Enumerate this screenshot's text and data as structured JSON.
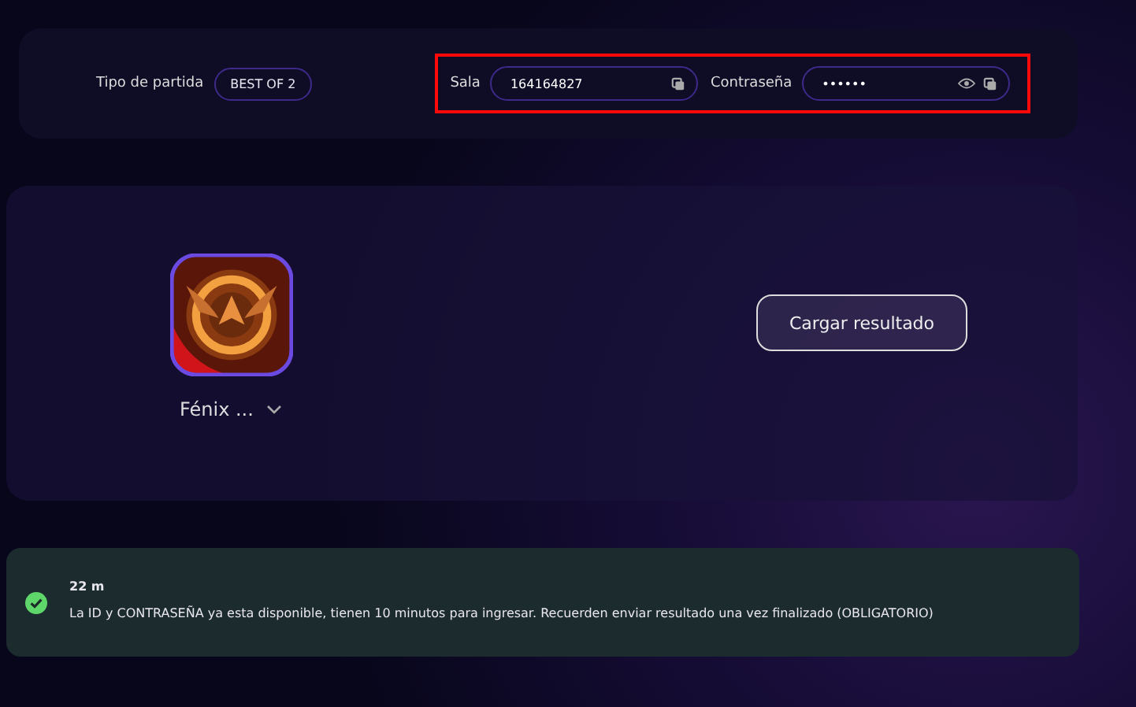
{
  "match": {
    "type_label": "Tipo de partida",
    "type_value": "BEST OF 2"
  },
  "credentials": {
    "highlighted": true,
    "room": {
      "label": "Sala",
      "value": "164164827"
    },
    "password": {
      "label": "Contraseña",
      "value": "••••••"
    }
  },
  "team": {
    "name": "Fénix ...",
    "expanded": false
  },
  "upload_button": "Cargar resultado",
  "toast": {
    "kind": "success",
    "time": "22 m",
    "message": "La ID y CONTRASEÑA ya esta disponible, tienen 10 minutos para ingresar. Recuerden enviar resultado una vez finalizado (OBLIGATORIO)"
  }
}
